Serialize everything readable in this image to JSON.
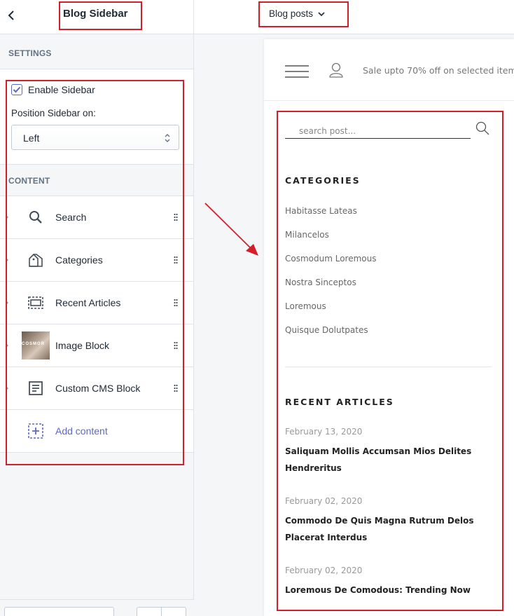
{
  "editor": {
    "title": "Blog Sidebar",
    "settings_label": "SETTINGS",
    "enable_sidebar_label": "Enable Sidebar",
    "enable_sidebar_checked": true,
    "position_label": "Position Sidebar on:",
    "position_value": "Left",
    "content_label": "CONTENT",
    "content_items": [
      {
        "label": "Search",
        "icon": "search-icon"
      },
      {
        "label": "Categories",
        "icon": "categories-icon"
      },
      {
        "label": "Recent Articles",
        "icon": "recent-articles-icon"
      },
      {
        "label": "Image Block",
        "icon": "image-thumbnail",
        "thumb_text": "COSMOR"
      },
      {
        "label": "Custom CMS Block",
        "icon": "document-icon"
      }
    ],
    "add_content_label": "Add content"
  },
  "topbar": {
    "page_select": "Blog posts"
  },
  "preview": {
    "promo_text": "Sale upto 70% off on selected item",
    "search_placeholder": "search post...",
    "categories_heading": "CATEGORIES",
    "categories": [
      "Habitasse Lateas",
      "Milancelos",
      "Cosmodum Loremous",
      "Nostra Sinceptos",
      "Loremous",
      "Quisque Dolutpates"
    ],
    "recent_heading": "RECENT ARTICLES",
    "articles": [
      {
        "date": "February 13, 2020",
        "title_line1": "Saliquam Mollis Accumsan Mios Delites",
        "title_line2": "Hendreritus"
      },
      {
        "date": "February 02, 2020",
        "title_line1": "Commodo De Quis Magna Rutrum Delos",
        "title_line2": "Placerat Interdus"
      },
      {
        "date": "February 02, 2020",
        "title_line1": "Loremous De Comodous: Trending Now",
        "title_line2": ""
      }
    ]
  },
  "colors": {
    "annotation_red": "#d31f2b",
    "accent_purple": "#5c6ac4"
  }
}
